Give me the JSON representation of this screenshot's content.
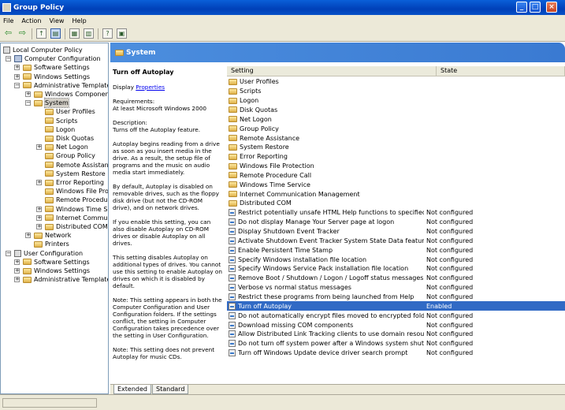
{
  "window": {
    "title": "Group Policy"
  },
  "menu": [
    "File",
    "Action",
    "View",
    "Help"
  ],
  "toolbar": {
    "icons": [
      "back-icon",
      "forward-icon",
      "up-folder-icon",
      "show-tree-icon",
      "properties-icon",
      "export-icon",
      "help-icon",
      "filter-icon"
    ]
  },
  "tree": {
    "items": [
      {
        "label": "Local Computer Policy",
        "icon": "policy",
        "expander": "",
        "level": 0
      },
      {
        "label": "Computer Configuration",
        "icon": "computer",
        "expander": "−",
        "level": 1
      },
      {
        "label": "Software Settings",
        "icon": "folder",
        "expander": "+",
        "level": 2
      },
      {
        "label": "Windows Settings",
        "icon": "folder",
        "expander": "+",
        "level": 2
      },
      {
        "label": "Administrative Templates",
        "icon": "folder",
        "expander": "−",
        "level": 2
      },
      {
        "label": "Windows Components",
        "icon": "folder",
        "expander": "+",
        "level": 3
      },
      {
        "label": "System",
        "icon": "folder",
        "expander": "−",
        "level": 3,
        "selected": true
      },
      {
        "label": "User Profiles",
        "icon": "folder",
        "expander": "",
        "level": 4
      },
      {
        "label": "Scripts",
        "icon": "folder",
        "expander": "",
        "level": 4
      },
      {
        "label": "Logon",
        "icon": "folder",
        "expander": "",
        "level": 4
      },
      {
        "label": "Disk Quotas",
        "icon": "folder",
        "expander": "",
        "level": 4
      },
      {
        "label": "Net Logon",
        "icon": "folder",
        "expander": "+",
        "level": 4
      },
      {
        "label": "Group Policy",
        "icon": "folder",
        "expander": "",
        "level": 4
      },
      {
        "label": "Remote Assistance",
        "icon": "folder",
        "expander": "",
        "level": 4
      },
      {
        "label": "System Restore",
        "icon": "folder",
        "expander": "",
        "level": 4
      },
      {
        "label": "Error Reporting",
        "icon": "folder",
        "expander": "+",
        "level": 4
      },
      {
        "label": "Windows File Prote",
        "icon": "folder",
        "expander": "",
        "level": 4
      },
      {
        "label": "Remote Procedure",
        "icon": "folder",
        "expander": "",
        "level": 4
      },
      {
        "label": "Windows Time Serv",
        "icon": "folder",
        "expander": "+",
        "level": 4
      },
      {
        "label": "Internet Communic",
        "icon": "folder",
        "expander": "+",
        "level": 4
      },
      {
        "label": "Distributed COM",
        "icon": "folder",
        "expander": "+",
        "level": 4
      },
      {
        "label": "Network",
        "icon": "folder",
        "expander": "+",
        "level": 3
      },
      {
        "label": "Printers",
        "icon": "folder",
        "expander": "",
        "level": 3
      },
      {
        "label": "User Configuration",
        "icon": "user",
        "expander": "−",
        "level": 1
      },
      {
        "label": "Software Settings",
        "icon": "folder",
        "expander": "+",
        "level": 2
      },
      {
        "label": "Windows Settings",
        "icon": "folder",
        "expander": "+",
        "level": 2
      },
      {
        "label": "Administrative Templates",
        "icon": "folder",
        "expander": "+",
        "level": 2
      }
    ]
  },
  "header": {
    "title": "System"
  },
  "description": {
    "title": "Turn off Autoplay",
    "display_label": "Display",
    "properties_link": "Properties",
    "requirements_label": "Requirements:",
    "requirements": "At least Microsoft Windows 2000",
    "description_label": "Description:",
    "description": "Turns off the Autoplay feature.",
    "paragraphs": [
      "Autoplay begins reading from a drive as soon as you insert media in the drive. As a result, the setup file of programs and the music on audio media start immediately.",
      "By default, Autoplay is disabled on removable drives, such as the floppy disk drive (but not the CD-ROM drive), and on network drives.",
      "If you enable this setting, you can also disable Autoplay on CD-ROM drives or disable Autoplay on all drives.",
      "This setting disables Autoplay on additional types of drives. You cannot use this setting to enable Autoplay on drives on which it is disabled by default.",
      "Note: This setting appears in both the Computer Configuration and User Configuration folders. If the settings conflict, the setting in Computer Configuration takes precedence over the setting in User Configuration.",
      "Note: This setting does not prevent Autoplay for music CDs."
    ]
  },
  "list": {
    "columns": [
      "Setting",
      "State"
    ],
    "rows": [
      {
        "setting": "User Profiles",
        "state": "",
        "type": "folder"
      },
      {
        "setting": "Scripts",
        "state": "",
        "type": "folder"
      },
      {
        "setting": "Logon",
        "state": "",
        "type": "folder"
      },
      {
        "setting": "Disk Quotas",
        "state": "",
        "type": "folder"
      },
      {
        "setting": "Net Logon",
        "state": "",
        "type": "folder"
      },
      {
        "setting": "Group Policy",
        "state": "",
        "type": "folder"
      },
      {
        "setting": "Remote Assistance",
        "state": "",
        "type": "folder"
      },
      {
        "setting": "System Restore",
        "state": "",
        "type": "folder"
      },
      {
        "setting": "Error Reporting",
        "state": "",
        "type": "folder"
      },
      {
        "setting": "Windows File Protection",
        "state": "",
        "type": "folder"
      },
      {
        "setting": "Remote Procedure Call",
        "state": "",
        "type": "folder"
      },
      {
        "setting": "Windows Time Service",
        "state": "",
        "type": "folder"
      },
      {
        "setting": "Internet Communication Management",
        "state": "",
        "type": "folder"
      },
      {
        "setting": "Distributed COM",
        "state": "",
        "type": "folder"
      },
      {
        "setting": "Restrict potentially unsafe HTML Help functions to specified folders",
        "state": "Not configured",
        "type": "setting"
      },
      {
        "setting": "Do not display Manage Your Server page at logon",
        "state": "Not configured",
        "type": "setting"
      },
      {
        "setting": "Display Shutdown Event Tracker",
        "state": "Not configured",
        "type": "setting"
      },
      {
        "setting": "Activate Shutdown Event Tracker System State Data feature",
        "state": "Not configured",
        "type": "setting"
      },
      {
        "setting": "Enable Persistent Time Stamp",
        "state": "Not configured",
        "type": "setting"
      },
      {
        "setting": "Specify Windows installation file location",
        "state": "Not configured",
        "type": "setting"
      },
      {
        "setting": "Specify Windows Service Pack installation file location",
        "state": "Not configured",
        "type": "setting"
      },
      {
        "setting": "Remove Boot / Shutdown / Logon / Logoff status messages",
        "state": "Not configured",
        "type": "setting"
      },
      {
        "setting": "Verbose vs normal status messages",
        "state": "Not configured",
        "type": "setting"
      },
      {
        "setting": "Restrict these programs from being launched from Help",
        "state": "Not configured",
        "type": "setting"
      },
      {
        "setting": "Turn off Autoplay",
        "state": "Enabled",
        "type": "setting",
        "selected": true
      },
      {
        "setting": "Do not automatically encrypt files moved to encrypted folders",
        "state": "Not configured",
        "type": "setting"
      },
      {
        "setting": "Download missing COM components",
        "state": "Not configured",
        "type": "setting"
      },
      {
        "setting": "Allow Distributed Link Tracking clients to use domain resources",
        "state": "Not configured",
        "type": "setting"
      },
      {
        "setting": "Do not turn off system power after a Windows system shutdown ...",
        "state": "Not configured",
        "type": "setting"
      },
      {
        "setting": "Turn off Windows Update device driver search prompt",
        "state": "Not configured",
        "type": "setting"
      }
    ]
  },
  "tabs": [
    "Extended",
    "Standard"
  ],
  "colors": {
    "title_bar": "#0a5fd8",
    "header_blue": "#4c8ede",
    "selection": "#316ac5"
  }
}
